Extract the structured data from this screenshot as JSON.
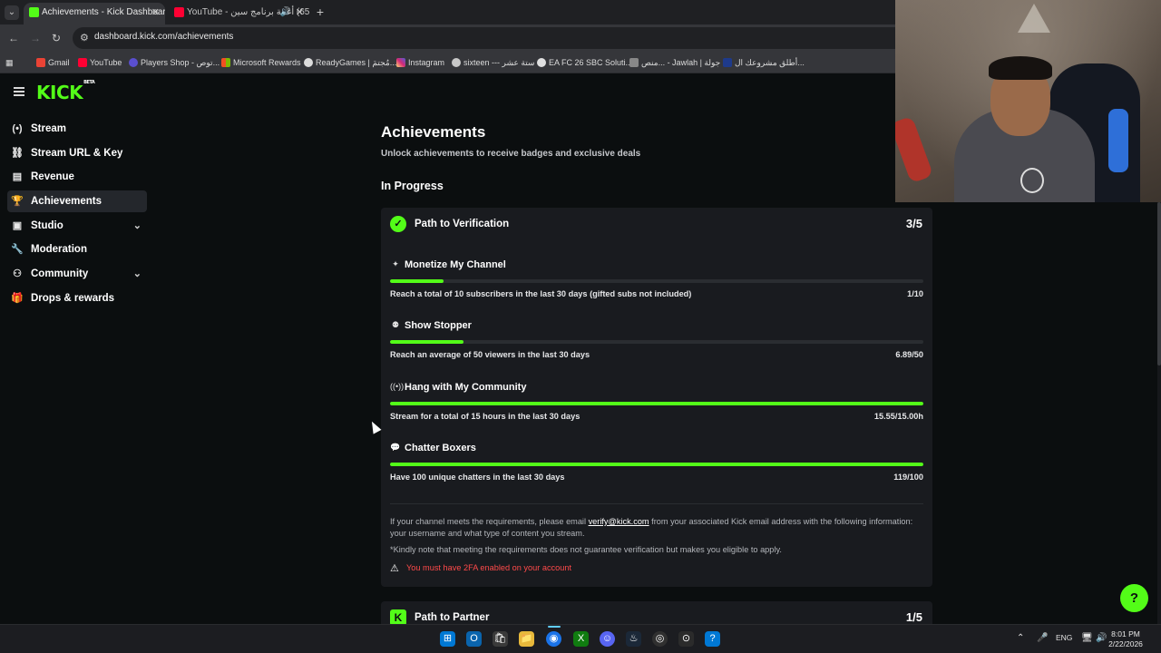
{
  "browser": {
    "tabs": [
      {
        "title": "Achievements - Kick Dashboard",
        "active": true
      },
      {
        "title": "(652) أغنية برنامج سين - YouTube",
        "active": false
      }
    ],
    "url": "dashboard.kick.com/achievements",
    "bookmarks": [
      "Gmail",
      "YouTube",
      "Players Shop - توص...",
      "Microsoft Rewards",
      "ReadyGames | مُجتمَ...",
      "Instagram",
      "sixteen --- ستة عشر",
      "EA FC 26 SBC Soluti...",
      "منص... - Jawlah | جولة",
      "أطلق مشروعك ال..."
    ]
  },
  "sidebar": {
    "logo": "KICK",
    "logo_badge": "BETA",
    "items": [
      {
        "label": "Stream",
        "icon": "stream-icon"
      },
      {
        "label": "Stream URL & Key",
        "icon": "link-icon"
      },
      {
        "label": "Revenue",
        "icon": "revenue-icon"
      },
      {
        "label": "Achievements",
        "icon": "trophy-icon",
        "active": true
      },
      {
        "label": "Studio",
        "icon": "studio-icon",
        "expandable": true
      },
      {
        "label": "Moderation",
        "icon": "wrench-icon"
      },
      {
        "label": "Community",
        "icon": "community-icon",
        "expandable": true
      },
      {
        "label": "Drops & rewards",
        "icon": "gift-icon"
      }
    ]
  },
  "main": {
    "title": "Achievements",
    "subtitle": "Unlock achievements to receive badges and exclusive deals",
    "section": "In Progress",
    "card1": {
      "title": "Path to Verification",
      "count": "3/5",
      "achievements": [
        {
          "name": "Monetize My Channel",
          "desc": "Reach a total of 10 subscribers in the last 30 days (gifted subs not included)",
          "value": "1/10",
          "progress": 0.1
        },
        {
          "name": "Show Stopper",
          "desc": "Reach an average of 50 viewers in the last 30 days",
          "value": "6.89/50",
          "progress": 0.1378
        },
        {
          "name": "Hang with My Community",
          "desc": "Stream for a total of 15 hours in the last 30 days",
          "value": "15.55/15.00h",
          "progress": 1.0
        },
        {
          "name": "Chatter Boxers",
          "desc": "Have 100 unique chatters in the last 30 days",
          "value": "119/100",
          "progress": 1.0
        }
      ],
      "note_pre": "If your channel meets the requirements, please email ",
      "note_email": "verify@kick.com",
      "note_post": " from your associated Kick email address with the following information: your username and what type of content you stream.",
      "note2": "*Kindly note that meeting the requirements does not guarantee verification but makes you eligible to apply.",
      "warning": "You must have 2FA enabled on your account"
    },
    "card2": {
      "title": "Path to Partner",
      "count": "1/5"
    }
  },
  "taskbar": {
    "lang": "ENG",
    "time": "8:01 PM",
    "date": "2/22/2026"
  },
  "colors": {
    "accent": "#53fc18",
    "background": "#0b0e0f",
    "card": "#191b1f",
    "warning": "#ff4a4a"
  }
}
